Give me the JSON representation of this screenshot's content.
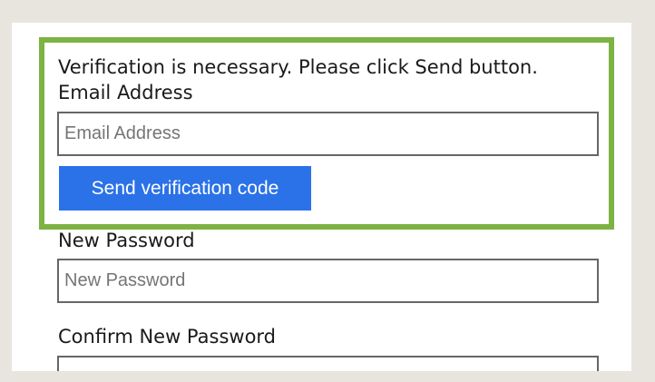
{
  "verification": {
    "message": "Verification is necessary. Please click Send button.",
    "email_label": "Email Address",
    "email_placeholder": "Email Address",
    "email_value": "",
    "send_button_label": "Send verification code"
  },
  "new_password": {
    "label": "New Password",
    "placeholder": "New Password",
    "value": ""
  },
  "confirm_password": {
    "label": "Confirm New Password",
    "placeholder": "",
    "value": ""
  },
  "colors": {
    "highlight_border": "#7cb342",
    "button_bg": "#2b72e8",
    "page_bg": "#e8e5df"
  }
}
